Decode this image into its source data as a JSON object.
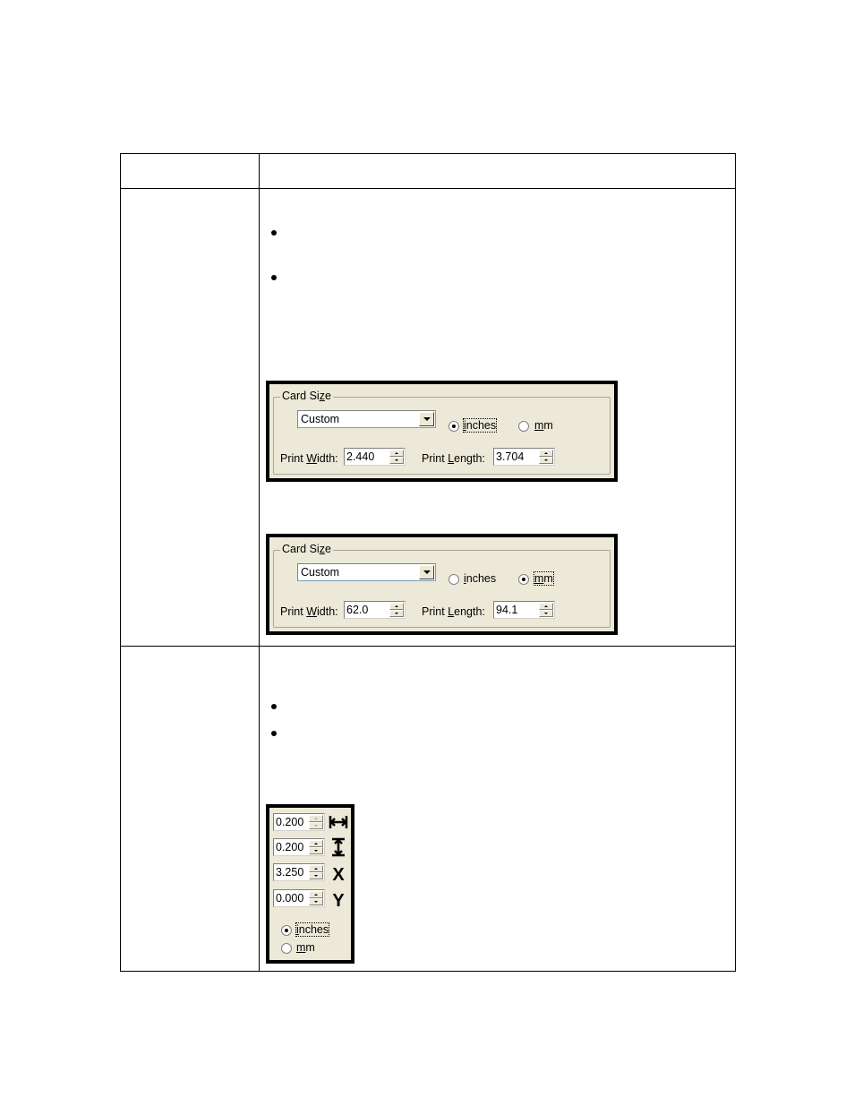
{
  "table": {
    "header": {
      "col1": "",
      "col2": ""
    },
    "row1": {
      "col1": "",
      "bullets": [
        "",
        ""
      ],
      "panels": [
        {
          "group_title": "Card Size",
          "group_title_mnemonic": "z",
          "dropdown_value": "Custom",
          "units": [
            {
              "label": "inches",
              "mnemonic": "i",
              "checked": true
            },
            {
              "label": "mm",
              "mnemonic": "m",
              "checked": false
            }
          ],
          "print_width_label": "Print Width:",
          "print_width_value": "2.440",
          "print_length_label": "Print Length:",
          "print_length_value": "3.704"
        },
        {
          "group_title": "Card Size",
          "group_title_mnemonic": "z",
          "dropdown_value": "Custom",
          "units": [
            {
              "label": "inches",
              "mnemonic": "i",
              "checked": false
            },
            {
              "label": "mm",
              "mnemonic": "m",
              "checked": true
            }
          ],
          "print_width_label": "Print Width:",
          "print_width_value": "62.0",
          "print_length_label": "Print Length:",
          "print_length_value": "94.1"
        }
      ]
    },
    "row2": {
      "col1": "",
      "bullets": [
        "",
        ""
      ],
      "margins_panel": {
        "fields": [
          {
            "value": "0.200",
            "icon": "width-arrows-icon",
            "glyph": "⟷",
            "disabled": true
          },
          {
            "value": "0.200",
            "icon": "height-arrows-icon",
            "glyph": "↕",
            "disabled": false
          },
          {
            "value": "3.250",
            "icon": "x-offset-icon",
            "glyph": "X",
            "disabled": false
          },
          {
            "value": "0.000",
            "icon": "y-offset-icon",
            "glyph": "Y",
            "disabled": false
          }
        ],
        "units": [
          {
            "label": "inches",
            "checked": true
          },
          {
            "label": "mm",
            "checked": false
          }
        ]
      }
    }
  }
}
